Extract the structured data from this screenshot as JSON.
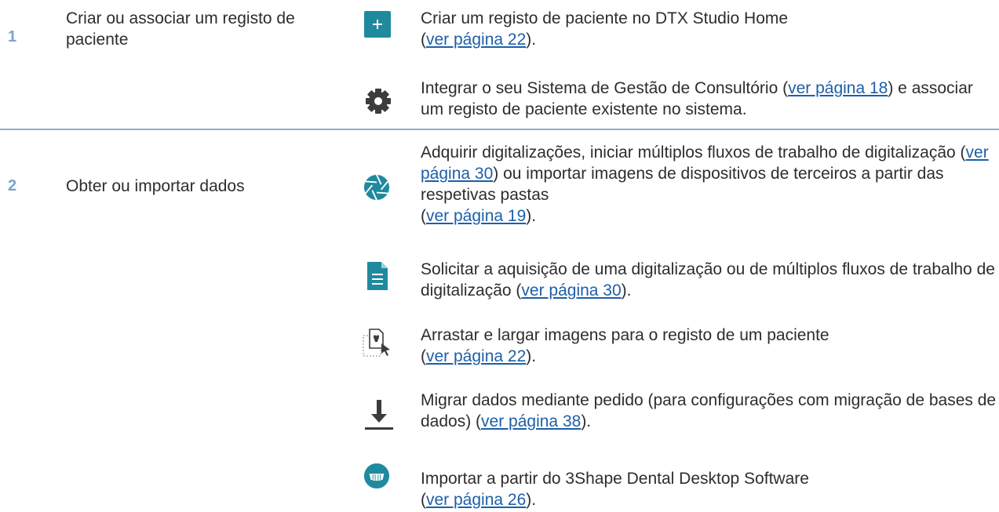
{
  "rows": [
    {
      "number": "1",
      "title": "Criar ou associar um registo de paciente",
      "items": [
        {
          "icon": "plus-icon",
          "text_a": "Criar um registo de paciente no DTX Studio Home",
          "open": "(",
          "link": "ver página 22",
          "close": ")."
        },
        {
          "icon": "gear-icon",
          "text_a": "Integrar o seu Sistema de Gestão de Consultório (",
          "link": "ver página 18",
          "text_b": ") e associar um registo de paciente existente no sistema."
        }
      ]
    },
    {
      "number": "2",
      "title": "Obter ou importar dados",
      "items": [
        {
          "icon": "aperture-icon",
          "text_a": "Adquirir digitalizações, iniciar múltiplos fluxos de trabalho de digitalização (",
          "link": "ver página 30",
          "text_b": ") ou importar imagens de dispositivos de terceiros a partir das respetivas pastas",
          "open": "(",
          "link2": "ver página 19",
          "close": ")."
        },
        {
          "icon": "document-icon",
          "text_a": "Solicitar a aquisição de uma digitalização ou de múltiplos fluxos de trabalho de digitalização (",
          "link": "ver página 30",
          "close": ")."
        },
        {
          "icon": "drag-drop-icon",
          "text_a": "Arrastar e largar imagens para o registo de um paciente",
          "open": "(",
          "link": "ver página 22",
          "close": ")."
        },
        {
          "icon": "download-icon",
          "text_a": "Migrar dados mediante pedido (para configurações com migração de bases de dados) (",
          "link": "ver página 38",
          "close": ")."
        },
        {
          "icon": "3shape-icon",
          "text_a": "Importar a partir do 3Shape Dental Desktop Software",
          "open": "(",
          "link": "ver página 26",
          "close": ")."
        }
      ]
    }
  ],
  "colors": {
    "step_number": "#7fa2cf",
    "divider": "#8eabd2",
    "icon_teal": "#1f8a9e",
    "icon_gray": "#3c3c3c",
    "link": "#1d5fa8",
    "body_text": "#2d2d2d"
  }
}
